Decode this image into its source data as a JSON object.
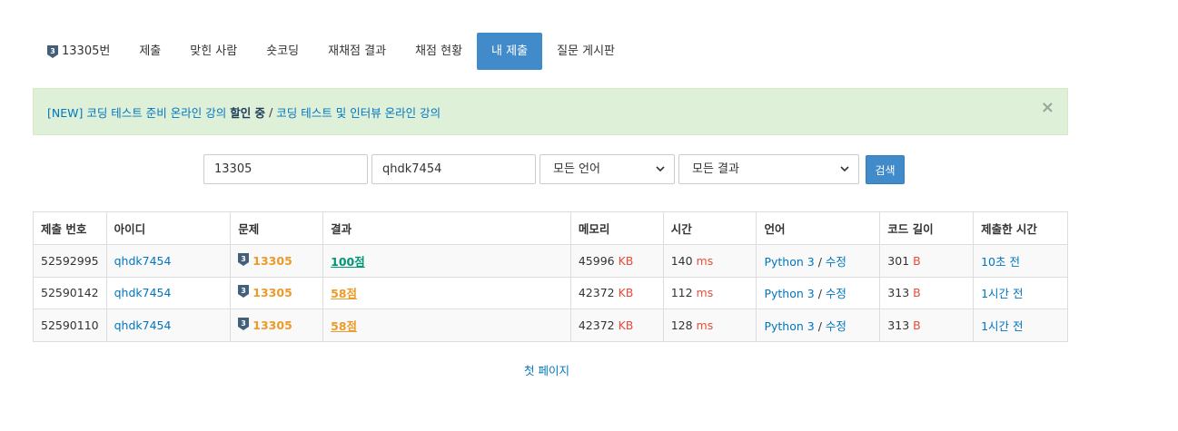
{
  "tabs": [
    {
      "label": "13305번",
      "badge": "3",
      "active": false
    },
    {
      "label": "제출",
      "active": false
    },
    {
      "label": "맞힌 사람",
      "active": false
    },
    {
      "label": "숏코딩",
      "active": false
    },
    {
      "label": "재채점 결과",
      "active": false
    },
    {
      "label": "채점 현황",
      "active": false
    },
    {
      "label": "내 제출",
      "active": true
    },
    {
      "label": "질문 게시판",
      "active": false
    }
  ],
  "alert": {
    "link1_prefix": "[NEW] 코딩 테스트 준비 온라인 강의 ",
    "link1_strong": "할인 중",
    "separator": "/",
    "link2": "코딩 테스트 및 인터뷰 온라인 강의",
    "close": "×"
  },
  "search": {
    "problem_value": "13305",
    "user_value": "qhdk7454",
    "language_selected": "모든 언어",
    "result_selected": "모든 결과",
    "button": "검색"
  },
  "table": {
    "headers": [
      "제출 번호",
      "아이디",
      "문제",
      "결과",
      "메모리",
      "시간",
      "언어",
      "코드 길이",
      "제출한 시간"
    ],
    "rows": [
      {
        "id": "52592995",
        "user": "qhdk7454",
        "tier": "3",
        "problem": "13305",
        "result": "100점",
        "result_type": "ac",
        "memory": "45996",
        "memory_unit": "KB",
        "time": "140",
        "time_unit": "ms",
        "language": "Python 3",
        "edit": "수정",
        "length": "301",
        "length_unit": "B",
        "submitted": "10초 전"
      },
      {
        "id": "52590142",
        "user": "qhdk7454",
        "tier": "3",
        "problem": "13305",
        "result": "58점",
        "result_type": "partial",
        "memory": "42372",
        "memory_unit": "KB",
        "time": "112",
        "time_unit": "ms",
        "language": "Python 3",
        "edit": "수정",
        "length": "313",
        "length_unit": "B",
        "submitted": "1시간 전"
      },
      {
        "id": "52590110",
        "user": "qhdk7454",
        "tier": "3",
        "problem": "13305",
        "result": "58점",
        "result_type": "partial",
        "memory": "42372",
        "memory_unit": "KB",
        "time": "128",
        "time_unit": "ms",
        "language": "Python 3",
        "edit": "수정",
        "length": "313",
        "length_unit": "B",
        "submitted": "1시간 전"
      }
    ]
  },
  "pager": {
    "first_page": "첫 페이지"
  },
  "colors": {
    "accent": "#428bca",
    "alert_bg": "#dff0d8",
    "link": "#0076c0",
    "ac": "#009874",
    "partial": "#ec9a29",
    "unit": "#e74c3c",
    "tier_badge": "#435f7a"
  }
}
